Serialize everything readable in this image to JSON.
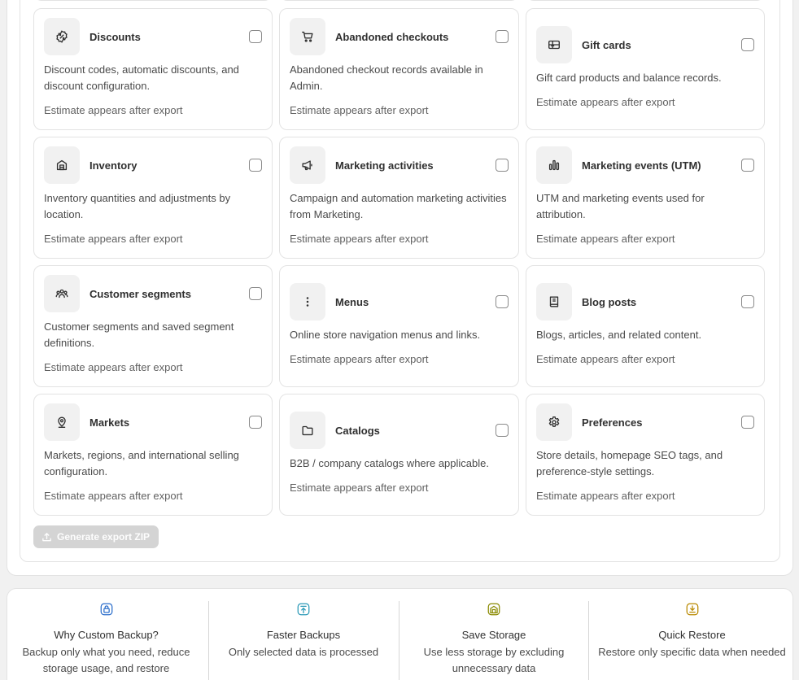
{
  "tiles": [
    {
      "title": "Discounts",
      "icon": "discount-icon",
      "desc": "Discount codes, automatic discounts, and discount configuration.",
      "estimate": "Estimate appears after export"
    },
    {
      "title": "Abandoned checkouts",
      "icon": "cart-icon",
      "desc": "Abandoned checkout records available in Admin.",
      "estimate": "Estimate appears after export"
    },
    {
      "title": "Gift cards",
      "icon": "gift-card-icon",
      "desc": "Gift card products and balance records.",
      "estimate": "Estimate appears after export"
    },
    {
      "title": "Inventory",
      "icon": "inventory-icon",
      "desc": "Inventory quantities and adjustments by location.",
      "estimate": "Estimate appears after export"
    },
    {
      "title": "Marketing activities",
      "icon": "megaphone-icon",
      "desc": "Campaign and automation marketing activities from Marketing.",
      "estimate": "Estimate appears after export"
    },
    {
      "title": "Marketing events (UTM)",
      "icon": "bar-chart-icon",
      "desc": "UTM and marketing events used for attribution.",
      "estimate": "Estimate appears after export"
    },
    {
      "title": "Customer segments",
      "icon": "people-icon",
      "desc": "Customer segments and saved segment definitions.",
      "estimate": "Estimate appears after export"
    },
    {
      "title": "Menus",
      "icon": "more-vertical-icon",
      "desc": "Online store navigation menus and links.",
      "estimate": "Estimate appears after export"
    },
    {
      "title": "Blog posts",
      "icon": "blog-icon",
      "desc": "Blogs, articles, and related content.",
      "estimate": "Estimate appears after export"
    },
    {
      "title": "Markets",
      "icon": "location-pin-icon",
      "desc": "Markets, regions, and international selling configuration.",
      "estimate": "Estimate appears after export"
    },
    {
      "title": "Catalogs",
      "icon": "folder-icon",
      "desc": "B2B / company catalogs where applicable.",
      "estimate": "Estimate appears after export"
    },
    {
      "title": "Preferences",
      "icon": "gear-icon",
      "desc": "Store details, homepage SEO tags, and preference-style settings.",
      "estimate": "Estimate appears after export"
    }
  ],
  "generate_button": "Generate export ZIP",
  "features": [
    {
      "icon": "lock-icon",
      "title": "Why Custom Backup?",
      "desc": "Backup only what you need, reduce storage usage, and restore",
      "color": "#2c6ecb"
    },
    {
      "icon": "upload-icon",
      "title": "Faster Backups",
      "desc": "Only selected data is processed",
      "color": "#2c9ab7"
    },
    {
      "icon": "storage-icon",
      "title": "Save Storage",
      "desc": "Use less storage by excluding unnecessary data",
      "color": "#8a8a00"
    },
    {
      "icon": "download-icon",
      "title": "Quick Restore",
      "desc": "Restore only specific data when needed",
      "color": "#b98900"
    }
  ]
}
